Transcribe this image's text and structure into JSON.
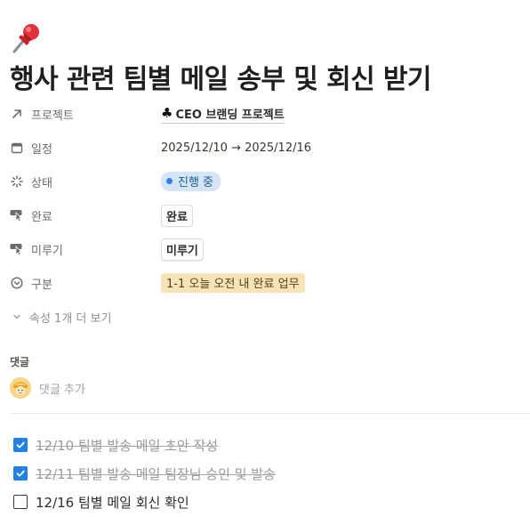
{
  "page": {
    "icon": "pushpin-icon",
    "title": "행사 관련 팀별 메일 송부 및 회신 받기"
  },
  "properties": [
    {
      "key": "project",
      "icon": "arrow-up-right-icon",
      "label": "프로젝트",
      "type": "relation",
      "value": "CEO 브랜딩 프로젝트",
      "value_icon": "♣"
    },
    {
      "key": "schedule",
      "icon": "calendar-icon",
      "label": "일정",
      "type": "date",
      "value": "2025/12/10 → 2025/12/16"
    },
    {
      "key": "status",
      "icon": "loading-icon",
      "label": "상태",
      "type": "status",
      "value": "진행 중",
      "color": "#2f80ed"
    },
    {
      "key": "done",
      "icon": "pointer-icon",
      "label": "완료",
      "type": "button",
      "value": "완료"
    },
    {
      "key": "postpone",
      "icon": "pointer-icon",
      "label": "미루기",
      "type": "button",
      "value": "미루기"
    },
    {
      "key": "category",
      "icon": "circle-chevron-icon",
      "label": "구분",
      "type": "select",
      "value": "1-1 오늘 오전 내 완료 업무",
      "color": "#f6e4b9"
    }
  ],
  "more_properties": {
    "icon": "chevron-down-icon",
    "label": "속성 1개 더 보기"
  },
  "comments": {
    "heading": "댓글",
    "placeholder": "댓글 추가",
    "avatar_icon": "avatar-icon"
  },
  "todos": [
    {
      "text": "12/10 팀별 발송 메일 초안 작성",
      "checked": true
    },
    {
      "text": "12/11 팀별 발송 메일 팀장님 승인 및 발송",
      "checked": true
    },
    {
      "text": "12/16 팀별 메일 회신 확인",
      "checked": false
    }
  ],
  "colors": {
    "checkbox_checked": "#2383e2",
    "status_bg": "#d3e5f7",
    "select_bg": "#f6e4b9"
  }
}
